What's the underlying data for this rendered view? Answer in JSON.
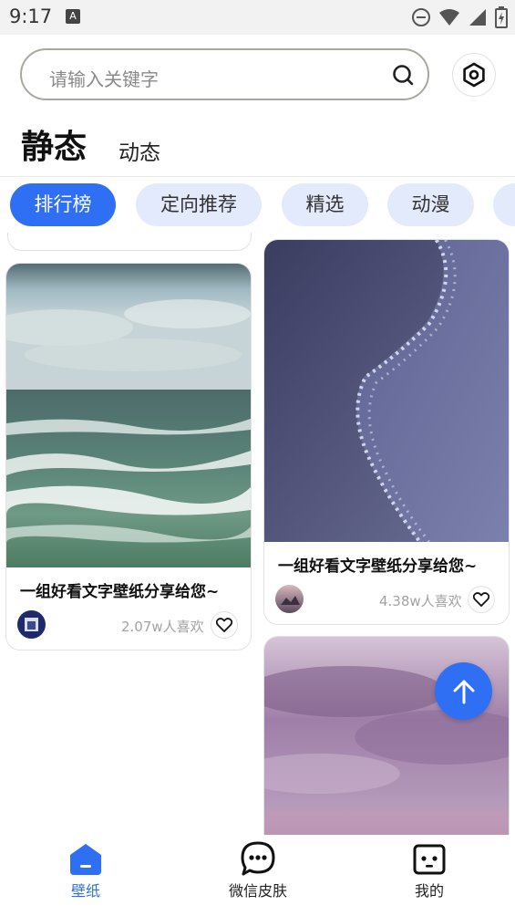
{
  "status_bar": {
    "time": "9:17",
    "a_badge": "A"
  },
  "search": {
    "placeholder": "请输入关键字"
  },
  "tabs": {
    "static": "静态",
    "dynamic": "动态"
  },
  "chips": [
    {
      "label": "排行榜",
      "active": true
    },
    {
      "label": "定向推荐",
      "active": false
    },
    {
      "label": "精选",
      "active": false
    },
    {
      "label": "动漫",
      "active": false
    }
  ],
  "cards": [
    {
      "title": "一组好看文字壁纸分享给您~",
      "likes": "2.07w人喜欢",
      "image": "ocean-waves-green"
    },
    {
      "title": "一组好看文字壁纸分享给您~",
      "likes": "4.38w人喜欢",
      "image": "beach-foam-purple"
    },
    {
      "title": "",
      "likes": "",
      "image": "purple-sky-sea"
    }
  ],
  "bottom_nav": [
    {
      "label": "壁纸",
      "icon": "home-icon",
      "active": true
    },
    {
      "label": "微信皮肤",
      "icon": "chat-bubble-icon",
      "active": false
    },
    {
      "label": "我的",
      "icon": "profile-icon",
      "active": false
    }
  ],
  "colors": {
    "accent": "#2f6ff3",
    "chip_bg": "#e3eafb",
    "text_muted": "#a3a3a3"
  }
}
